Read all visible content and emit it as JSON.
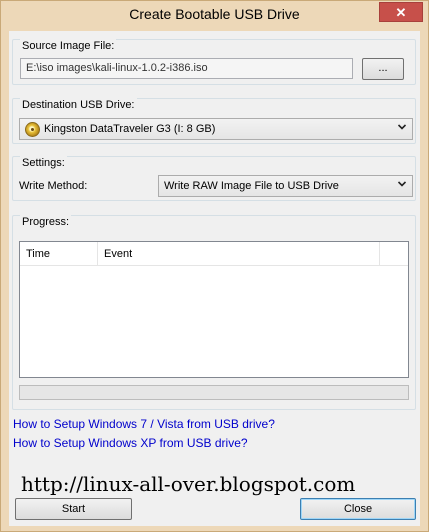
{
  "window": {
    "title": "Create Bootable USB Drive",
    "close_glyph": "✕"
  },
  "source": {
    "group_label": "Source Image File:",
    "path_value": "E:\\iso images\\kali-linux-1.0.2-i386.iso",
    "browse_label": "..."
  },
  "destination": {
    "group_label": "Destination USB Drive:",
    "selected": "Kingston DataTraveler G3 (I: 8 GB)",
    "icon": "usb-drive-icon"
  },
  "settings": {
    "group_label": "Settings:",
    "write_method_label": "Write Method:",
    "write_method_value": "Write RAW Image File to USB Drive"
  },
  "progress": {
    "group_label": "Progress:",
    "columns": [
      "Time",
      "Event"
    ],
    "value": 0
  },
  "links": [
    "How to Setup Windows 7 / Vista from USB drive?",
    "How to Setup Windows XP from USB drive?"
  ],
  "watermark": "http://linux-all-over.blogspot.com",
  "buttons": {
    "start": "Start",
    "close": "Close"
  },
  "colors": {
    "titlebar": "#edd8b8",
    "close_button": "#c7504a",
    "link": "#0000cc"
  }
}
